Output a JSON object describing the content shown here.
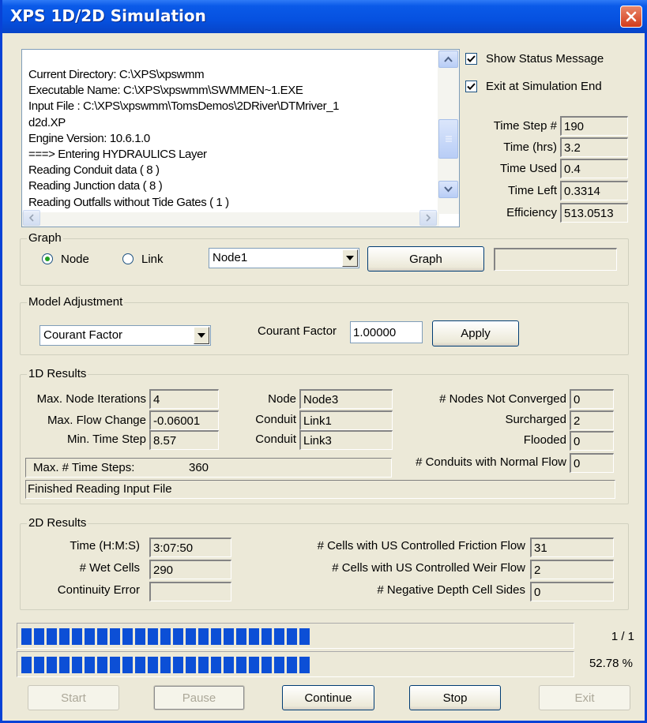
{
  "window": {
    "title": "XPS 1D/2D Simulation"
  },
  "log": {
    "lines": [
      "Current Directory: C:\\XPS\\xpswmm",
      "Executable Name: C:\\XPS\\xpswmm\\SWMMEN~1.EXE",
      "Input File : C:\\XPS\\xpswmm\\TomsDemos\\2DRiver\\DTMriver_1",
      "d2d.XP",
      "Engine Version: 10.6.1.0",
      "===> Entering HYDRAULICS Layer",
      "Reading Conduit data (     8 )",
      "Reading Junction data (     8 )",
      "Reading Outfalls without Tide Gates (     1 )"
    ]
  },
  "options": {
    "show_status_label": "Show Status Message",
    "show_status_checked": true,
    "exit_at_end_label": "Exit at Simulation End",
    "exit_at_end_checked": true
  },
  "stats": {
    "time_step_label": "Time Step #",
    "time_step": "190",
    "time_label": "Time (hrs)",
    "time": "3.2",
    "time_used_label": "Time Used",
    "time_used": "0.4",
    "time_left_label": "Time Left",
    "time_left": "0.3314",
    "efficiency_label": "Efficiency",
    "efficiency": "513.0513"
  },
  "graph": {
    "group_label": "Graph",
    "node_label": "Node",
    "link_label": "Link",
    "selected": "Node",
    "select_value": "Node1",
    "button_label": "Graph",
    "extra_value": ""
  },
  "model": {
    "group_label": "Model Adjustment",
    "select_value": "Courant Factor",
    "factor_label": "Courant Factor",
    "factor_value": "1.00000",
    "apply_label": "Apply"
  },
  "results1d": {
    "group_label": "1D Results",
    "max_node_iter_label": "Max. Node Iterations",
    "max_node_iter": "4",
    "max_flow_change_label": "Max. Flow Change",
    "max_flow_change": "-0.06001",
    "min_time_step_label": "Min. Time Step",
    "min_time_step": "8.57",
    "node_label": "Node",
    "node_value": "Node3",
    "conduit1_label": "Conduit",
    "conduit1_value": "Link1",
    "conduit2_label": "Conduit",
    "conduit2_value": "Link3",
    "not_converged_label": "# Nodes Not Converged",
    "not_converged": "0",
    "surcharged_label": "Surcharged",
    "surcharged": "2",
    "flooded_label": "Flooded",
    "flooded": "0",
    "normal_flow_label": "# Conduits with Normal Flow",
    "normal_flow": "0",
    "max_steps_label": "Max. # Time Steps:",
    "max_steps": "360",
    "status": "Finished Reading Input File"
  },
  "results2d": {
    "group_label": "2D Results",
    "time_label": "Time (H:M:S)",
    "time": "3:07:50",
    "wet_cells_label": "# Wet Cells",
    "wet_cells": "290",
    "continuity_label": "Continuity Error",
    "continuity": "",
    "friction_label": "# Cells with US Controlled Friction Flow",
    "friction": "31",
    "weir_label": "# Cells with US Controlled Weir Flow",
    "weir": "2",
    "neg_depth_label": "# Negative Depth Cell Sides",
    "neg_depth": "0"
  },
  "progress": {
    "bar1_fraction": 0.528,
    "bar1_text": "1 / 1",
    "bar2_fraction": 0.528,
    "bar2_text": "52.78 %"
  },
  "buttons": {
    "start": "Start",
    "pause": "Pause",
    "continue": "Continue",
    "stop": "Stop",
    "exit": "Exit"
  },
  "colors": {
    "titlebar": "#0651e0",
    "progress": "#0c4fd6",
    "face": "#ece9d8"
  }
}
